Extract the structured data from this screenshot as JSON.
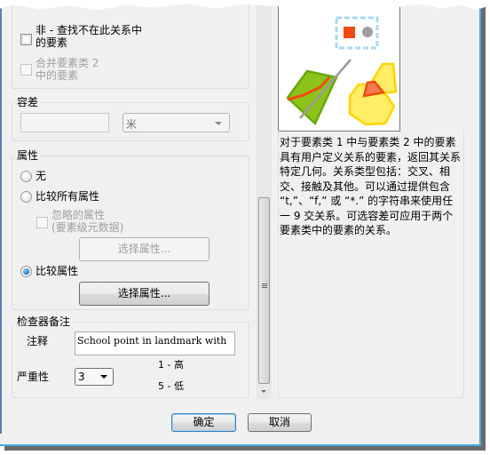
{
  "options": {
    "not_checkbox_label_line1": "非  -  查找不在此关系中",
    "not_checkbox_label_line2": "的要素",
    "merge_checkbox_label_line1": "合并要素类  2",
    "merge_checkbox_label_line2": "中的要素"
  },
  "tolerance": {
    "title": "容差",
    "value": "",
    "unit_selected": "米"
  },
  "attributes": {
    "title": "属性",
    "radio_none": "无",
    "radio_compare_all": "比较所有属性",
    "ignored_label_line1": "忽略的属性",
    "ignored_label_line2": "(要素级元数据)",
    "select_attributes_disabled": "选择属性...",
    "radio_compare": "比较属性",
    "select_attributes": "选择属性...",
    "selected_option": "比较属性"
  },
  "notes": {
    "title": "检查器备注",
    "comment_label": "注释",
    "comment_value": "School point in landmark with",
    "severity_label": "严重性",
    "severity_value": "3",
    "severity_high": "1 - 高",
    "severity_low": "5 - 低"
  },
  "description": "对于要素类 1 中与要素类 2 中的要素具有用户定义关系的要素，返回其关系特定几何。关系类型包括：交叉、相交、接触及其他。可以通过提供包含 “t,”、“f,” 或 “*.” 的字符串来使用任一 9 交关系。可选容差可应用于两个要素类中的要素的关系。",
  "preview_colors": {
    "red": "#f04a10",
    "gray": "#a0a0a0",
    "green": "#8cc21a",
    "green_border": "#6aa80c",
    "yellow": "#ffee66",
    "yellow_border": "#ffd400",
    "selection": "#a8d8f4"
  },
  "buttons": {
    "ok": "确定",
    "cancel": "取消"
  }
}
